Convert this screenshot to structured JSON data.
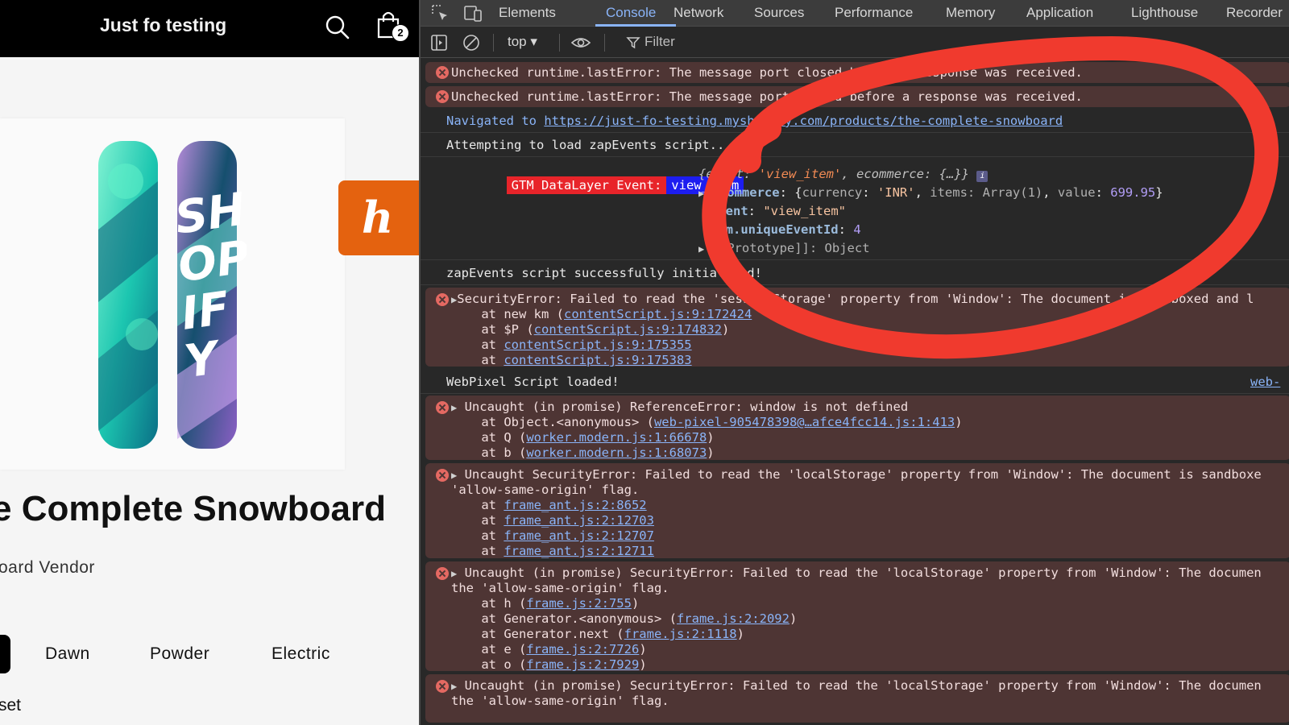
{
  "store": {
    "title": "Just fo testing",
    "cart_count": "2",
    "product_title": "e Complete Snowboard",
    "vendor": "oard Vendor",
    "variants": [
      "Dawn",
      "Powder",
      "Electric"
    ],
    "option_partial": "set",
    "accent": "#e4620f"
  },
  "devtools": {
    "tabs": [
      "Elements",
      "Console",
      "Network",
      "Sources",
      "Performance",
      "Memory",
      "Application",
      "Lighthouse",
      "Recorder"
    ],
    "active_tab": "Console",
    "context": "top ▾",
    "filter_placeholder": "Filter"
  },
  "console": {
    "err1": "Unchecked runtime.lastError: The message port closed before a response was received.",
    "err2": "Unchecked runtime.lastError: The message port closed before a response was received.",
    "nav_prefix": "Navigated to ",
    "nav_url": "https://just-fo-testing.myshopify.com/products/the-complete-snowboard",
    "attempt": "Attempting to load zapEvents script...",
    "gtm_label": "GTM DataLayer Event:",
    "gtm_event": "view_item",
    "obj_summary_event_key": "event",
    "obj_summary_event_val": "'view_item'",
    "obj_summary_ecom": "ecommerce: {…}}",
    "ecom_key": "ecommerce",
    "ecom_currency_key": "currency",
    "ecom_currency_val": "'INR'",
    "ecom_items": "items: Array(1)",
    "ecom_value_key": "value",
    "ecom_value": "699.95",
    "event_key": "event",
    "event_val": "\"view_item\"",
    "uid_key": "gtm.uniqueEventId",
    "uid_val": "4",
    "proto": "[[Prototype]]: Object",
    "zap_ok": "zapEvents script successfully initialized!",
    "sec1_head": "SecurityError: Failed to read the 'sessionStorage' property from 'Window': The document is sandboxed and l",
    "sec1_l1_pre": "    at new km (",
    "sec1_l1_link": "contentScript.js:9:172424",
    "sec1_l2_pre": "    at $P (",
    "sec1_l2_link": "contentScript.js:9:174832",
    "sec1_l3_link": "contentScript.js:9:175355",
    "sec1_l4_link": "contentScript.js:9:175383",
    "webpixel": "WebPixel Script loaded!",
    "webpixel_src": "web-",
    "ref_head": "Uncaught (in promise) ReferenceError: window is not defined",
    "ref_l1_pre": "    at Object.<anonymous> (",
    "ref_l1_link": "web-pixel-905478398@…afce4fcc14.js:1:413",
    "ref_l2_pre": "    at Q (",
    "ref_l2_link": "worker.modern.js:1:66678",
    "ref_l3_pre": "    at b (",
    "ref_l3_link": "worker.modern.js:1:68073",
    "ls1_head": "Uncaught SecurityError: Failed to read the 'localStorage' property from 'Window': The document is sandboxe",
    "ls1_head2": "'allow-same-origin' flag.",
    "ls1_links": [
      "frame_ant.js:2:8652",
      "frame_ant.js:2:12703",
      "frame_ant.js:2:12707",
      "frame_ant.js:2:12711"
    ],
    "ls2_head": "Uncaught (in promise) SecurityError: Failed to read the 'localStorage' property from 'Window': The documen",
    "ls2_head2": "the 'allow-same-origin' flag.",
    "ls2_l1_pre": "    at h (",
    "ls2_l1_link": "frame.js:2:755",
    "ls2_l2_pre": "    at Generator.<anonymous> (",
    "ls2_l2_link": "frame.js:2:2092",
    "ls2_l3_pre": "    at Generator.next (",
    "ls2_l3_link": "frame.js:2:1118",
    "ls2_l4_pre": "    at e (",
    "ls2_l4_link": "frame.js:2:7726",
    "ls2_l5_pre": "    at o (",
    "ls2_l5_link": "frame.js:2:7929",
    "ls3_head": "Uncaught (in promise) SecurityError: Failed to read the 'localStorage' property from 'Window': The documen",
    "ls3_head2": "the 'allow-same-origin' flag."
  },
  "colors": {
    "annotation": "#f03a2e",
    "error_bg": "#4e3534",
    "link": "#8ab4f8"
  }
}
